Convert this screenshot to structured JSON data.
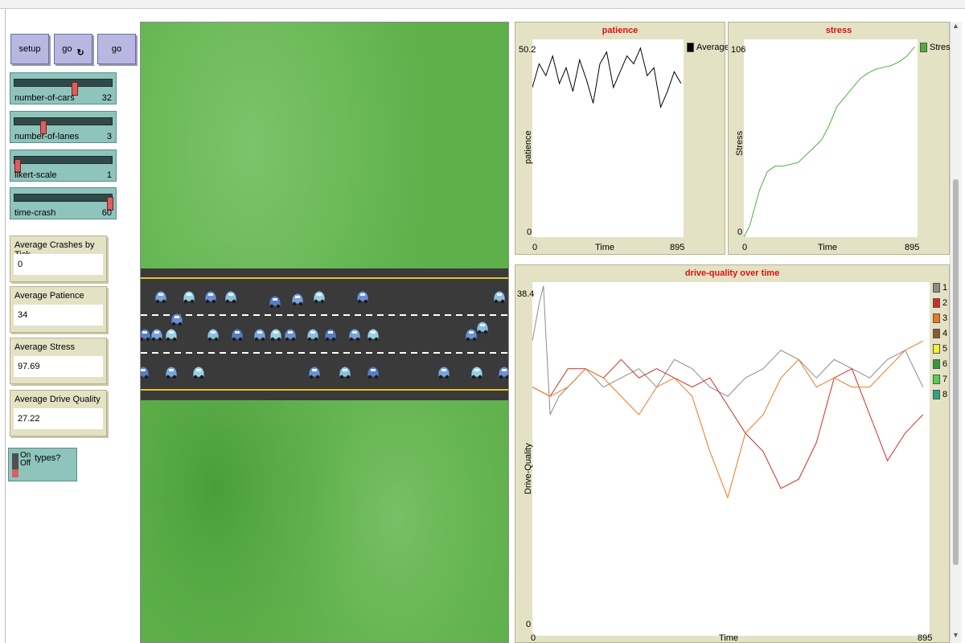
{
  "buttons": {
    "setup": "setup",
    "go_forever": "go",
    "go_forever_icon": "forever-icon",
    "go_once": "go"
  },
  "sliders": [
    {
      "name": "number-of-cars",
      "value": "32",
      "fraction": 0.62
    },
    {
      "name": "number-of-lanes",
      "value": "3",
      "fraction": 0.28
    },
    {
      "name": "likert-scale",
      "value": "1",
      "fraction": 0.0
    },
    {
      "name": "time-crash",
      "value": "60",
      "fraction": 1.0
    }
  ],
  "monitors": [
    {
      "label": "Average Crashes by Tick",
      "value": "0"
    },
    {
      "label": "Average Patience",
      "value": "34"
    },
    {
      "label": "Average Stress",
      "value": "97.69"
    },
    {
      "label": "Average Drive Quality",
      "value": "27.22"
    }
  ],
  "switch": {
    "on": "On",
    "off": "Off",
    "label": "types?",
    "state": "off"
  },
  "colors": {
    "world_grass": "#5db04a",
    "road": "#3a3a3a",
    "road_edge": "#e3c52c",
    "lane_mark": "#ffffff",
    "plot_title": "#e01010",
    "plot_bg": "#e4e2c4",
    "slider": "#8ec4bc",
    "button": "#b7b7e0",
    "monitor": "#e4e2c4"
  },
  "world": {
    "car_icon": "car-icon"
  },
  "chart_data": [
    {
      "type": "line",
      "title": "patience",
      "xlabel": "Time",
      "ylabel": "patience",
      "x_ticks": [
        "0",
        "895"
      ],
      "y_ticks": [
        "0",
        "50.2"
      ],
      "xlim": [
        0,
        895
      ],
      "ylim": [
        0,
        50.2
      ],
      "legend_position": "top-right",
      "series": [
        {
          "name": "Average",
          "color": "#000000",
          "x": [
            0,
            40,
            80,
            120,
            160,
            200,
            240,
            280,
            320,
            360,
            400,
            440,
            480,
            520,
            560,
            600,
            640,
            680,
            720,
            760,
            800,
            840,
            880
          ],
          "y": [
            38,
            44,
            41,
            46,
            39,
            43,
            37,
            45,
            40,
            34,
            44,
            47,
            38,
            42,
            46,
            44,
            48,
            41,
            43,
            33,
            37,
            42,
            39
          ]
        }
      ]
    },
    {
      "type": "line",
      "title": "stress",
      "xlabel": "Time",
      "ylabel": "Stress",
      "x_ticks": [
        "0",
        "895"
      ],
      "y_ticks": [
        "0",
        "106"
      ],
      "xlim": [
        0,
        895
      ],
      "ylim": [
        0,
        106
      ],
      "legend_position": "top-right",
      "series": [
        {
          "name": "Stress",
          "color": "#4caf3c",
          "x": [
            0,
            30,
            80,
            120,
            160,
            200,
            240,
            280,
            320,
            360,
            400,
            440,
            480,
            520,
            560,
            600,
            640,
            680,
            720,
            760,
            800,
            840,
            880
          ],
          "y": [
            0,
            6,
            25,
            35,
            38,
            38,
            39,
            40,
            44,
            48,
            52,
            60,
            70,
            75,
            80,
            85,
            88,
            90,
            91,
            92,
            94,
            97,
            102
          ]
        }
      ]
    },
    {
      "type": "line",
      "title": "drive-quality over time",
      "xlabel": "Time",
      "ylabel": "Drive-Quality",
      "x_ticks": [
        "0",
        "895"
      ],
      "y_ticks": [
        "0",
        "38.4"
      ],
      "xlim": [
        0,
        895
      ],
      "ylim": [
        0,
        38.4
      ],
      "legend_position": "right",
      "series": [
        {
          "name": "1",
          "color": "#8c8c8c",
          "x": [
            0,
            15,
            25,
            30,
            40,
            60,
            80,
            120,
            160,
            200,
            240,
            280,
            320,
            360,
            400,
            440,
            480,
            520,
            560,
            600,
            640,
            680,
            720,
            760,
            800,
            840,
            880
          ],
          "y": [
            32,
            36,
            38,
            33,
            24,
            26,
            27,
            29,
            27,
            28,
            29,
            27,
            30,
            29,
            27,
            26,
            28,
            29,
            31,
            30,
            28,
            30,
            29,
            28,
            30,
            31,
            27
          ]
        },
        {
          "name": "2",
          "color": "#d42a2a",
          "x": [
            0,
            40,
            80,
            120,
            160,
            200,
            240,
            280,
            320,
            360,
            400,
            440,
            480,
            520,
            560,
            600,
            640,
            680,
            720,
            760,
            800,
            840,
            880
          ],
          "y": [
            27,
            26,
            29,
            29,
            28,
            30,
            28,
            29,
            28,
            27,
            28,
            25,
            22,
            20,
            16,
            17,
            21,
            28,
            29,
            24,
            19,
            22,
            24
          ]
        },
        {
          "name": "3",
          "color": "#f07820",
          "x": [
            0,
            40,
            80,
            120,
            160,
            200,
            240,
            280,
            320,
            360,
            400,
            440,
            480,
            520,
            560,
            600,
            640,
            680,
            720,
            760,
            800,
            840,
            880
          ],
          "y": [
            27,
            26,
            27,
            29,
            28,
            26,
            24,
            27,
            28,
            26,
            20,
            15,
            22,
            24,
            28,
            30,
            27,
            28,
            27,
            27,
            29,
            31,
            32
          ]
        }
      ]
    }
  ],
  "drive_quality_legend": [
    {
      "label": "1",
      "color": "#8c8c8c"
    },
    {
      "label": "2",
      "color": "#d42a2a"
    },
    {
      "label": "3",
      "color": "#f07820"
    },
    {
      "label": "4",
      "color": "#8a5a2a"
    },
    {
      "label": "5",
      "color": "#f2f230"
    },
    {
      "label": "6",
      "color": "#2f9e3a"
    },
    {
      "label": "7",
      "color": "#52d24a"
    },
    {
      "label": "8",
      "color": "#2aa688"
    }
  ]
}
